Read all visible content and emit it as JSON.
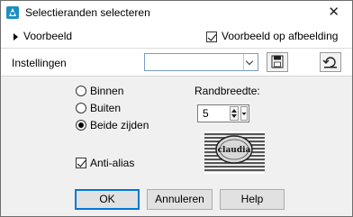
{
  "window": {
    "title": "Selectieranden selecteren",
    "close_glyph": "✕"
  },
  "preview_bar": {
    "toggle_label": "Voorbeeld",
    "preview_on_image_label": "Voorbeeld op afbeelding",
    "preview_on_image_checked": true
  },
  "settings": {
    "label": "Instellingen",
    "preset_value": ""
  },
  "border_options": {
    "options": [
      {
        "label": "Binnen",
        "selected": false
      },
      {
        "label": "Buiten",
        "selected": false
      },
      {
        "label": "Beide zijden",
        "selected": true
      }
    ]
  },
  "border_width": {
    "label": "Randbreedte:",
    "value": "5"
  },
  "antialias": {
    "label": "Anti-alias",
    "checked": true
  },
  "buttons": {
    "ok": "OK",
    "cancel": "Annuleren",
    "help": "Help"
  },
  "preview_image": {
    "watermark_text": "claudia"
  },
  "colors": {
    "accent": "#0078d7",
    "dialog_bg": "#f0f0f0"
  }
}
